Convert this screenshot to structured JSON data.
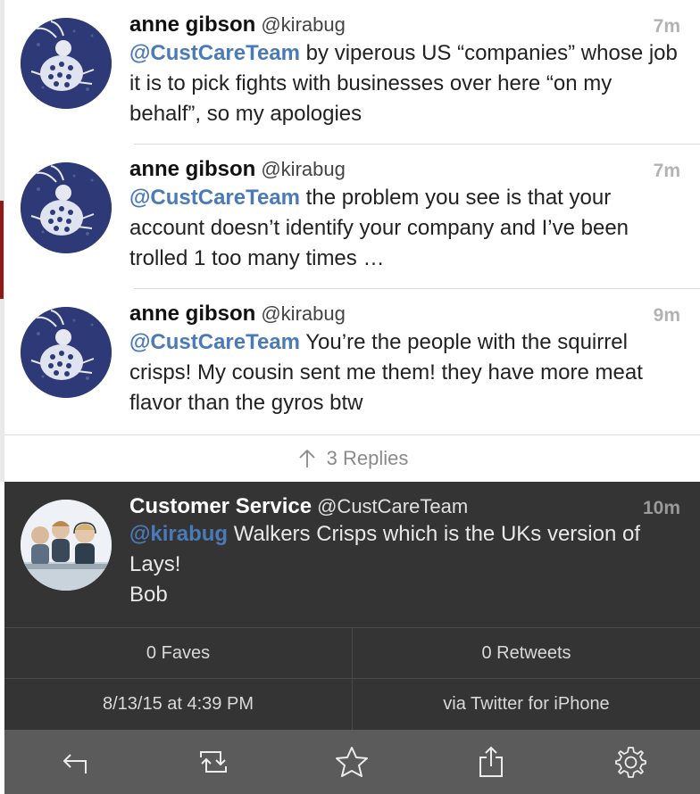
{
  "tweets": [
    {
      "name": "anne gibson",
      "handle": "@kirabug",
      "time": "7m",
      "mention": "@CustCareTeam",
      "text": " by viperous US “companies” whose job it is to pick fights with businesses over here “on my behalf”, so my apologies"
    },
    {
      "name": "anne gibson",
      "handle": "@kirabug",
      "time": "7m",
      "mention": "@CustCareTeam",
      "text": " the problem you see is that your account doesn’t identify your company and I’ve been trolled 1 too many times …"
    },
    {
      "name": "anne gibson",
      "handle": "@kirabug",
      "time": "9m",
      "mention": "@CustCareTeam",
      "text": " You’re the people with the squirrel crisps! My cousin sent me them! they have more meat flavor than the gyros btw"
    }
  ],
  "replies": {
    "label": "3 Replies",
    "icon": "arrow-up-icon"
  },
  "main_tweet": {
    "name": "Customer Service",
    "handle": "@CustCareTeam",
    "time": "10m",
    "mention": "@kirabug",
    "text_line1": " Walkers Crisps which is the UKs version of Lays!",
    "text_line2": "Bob"
  },
  "stats": {
    "faves": "0 Faves",
    "retweets": "0 Retweets",
    "date": "8/13/15 at 4:39 PM",
    "via": "via Twitter for iPhone"
  },
  "toolbar": {
    "icons": [
      "reply-icon",
      "retweet-icon",
      "star-icon",
      "share-icon",
      "gear-icon"
    ]
  },
  "colors": {
    "mention": "#4a7ab8",
    "dark_bg": "#343434",
    "toolbar_bg": "#5b5b5b"
  }
}
